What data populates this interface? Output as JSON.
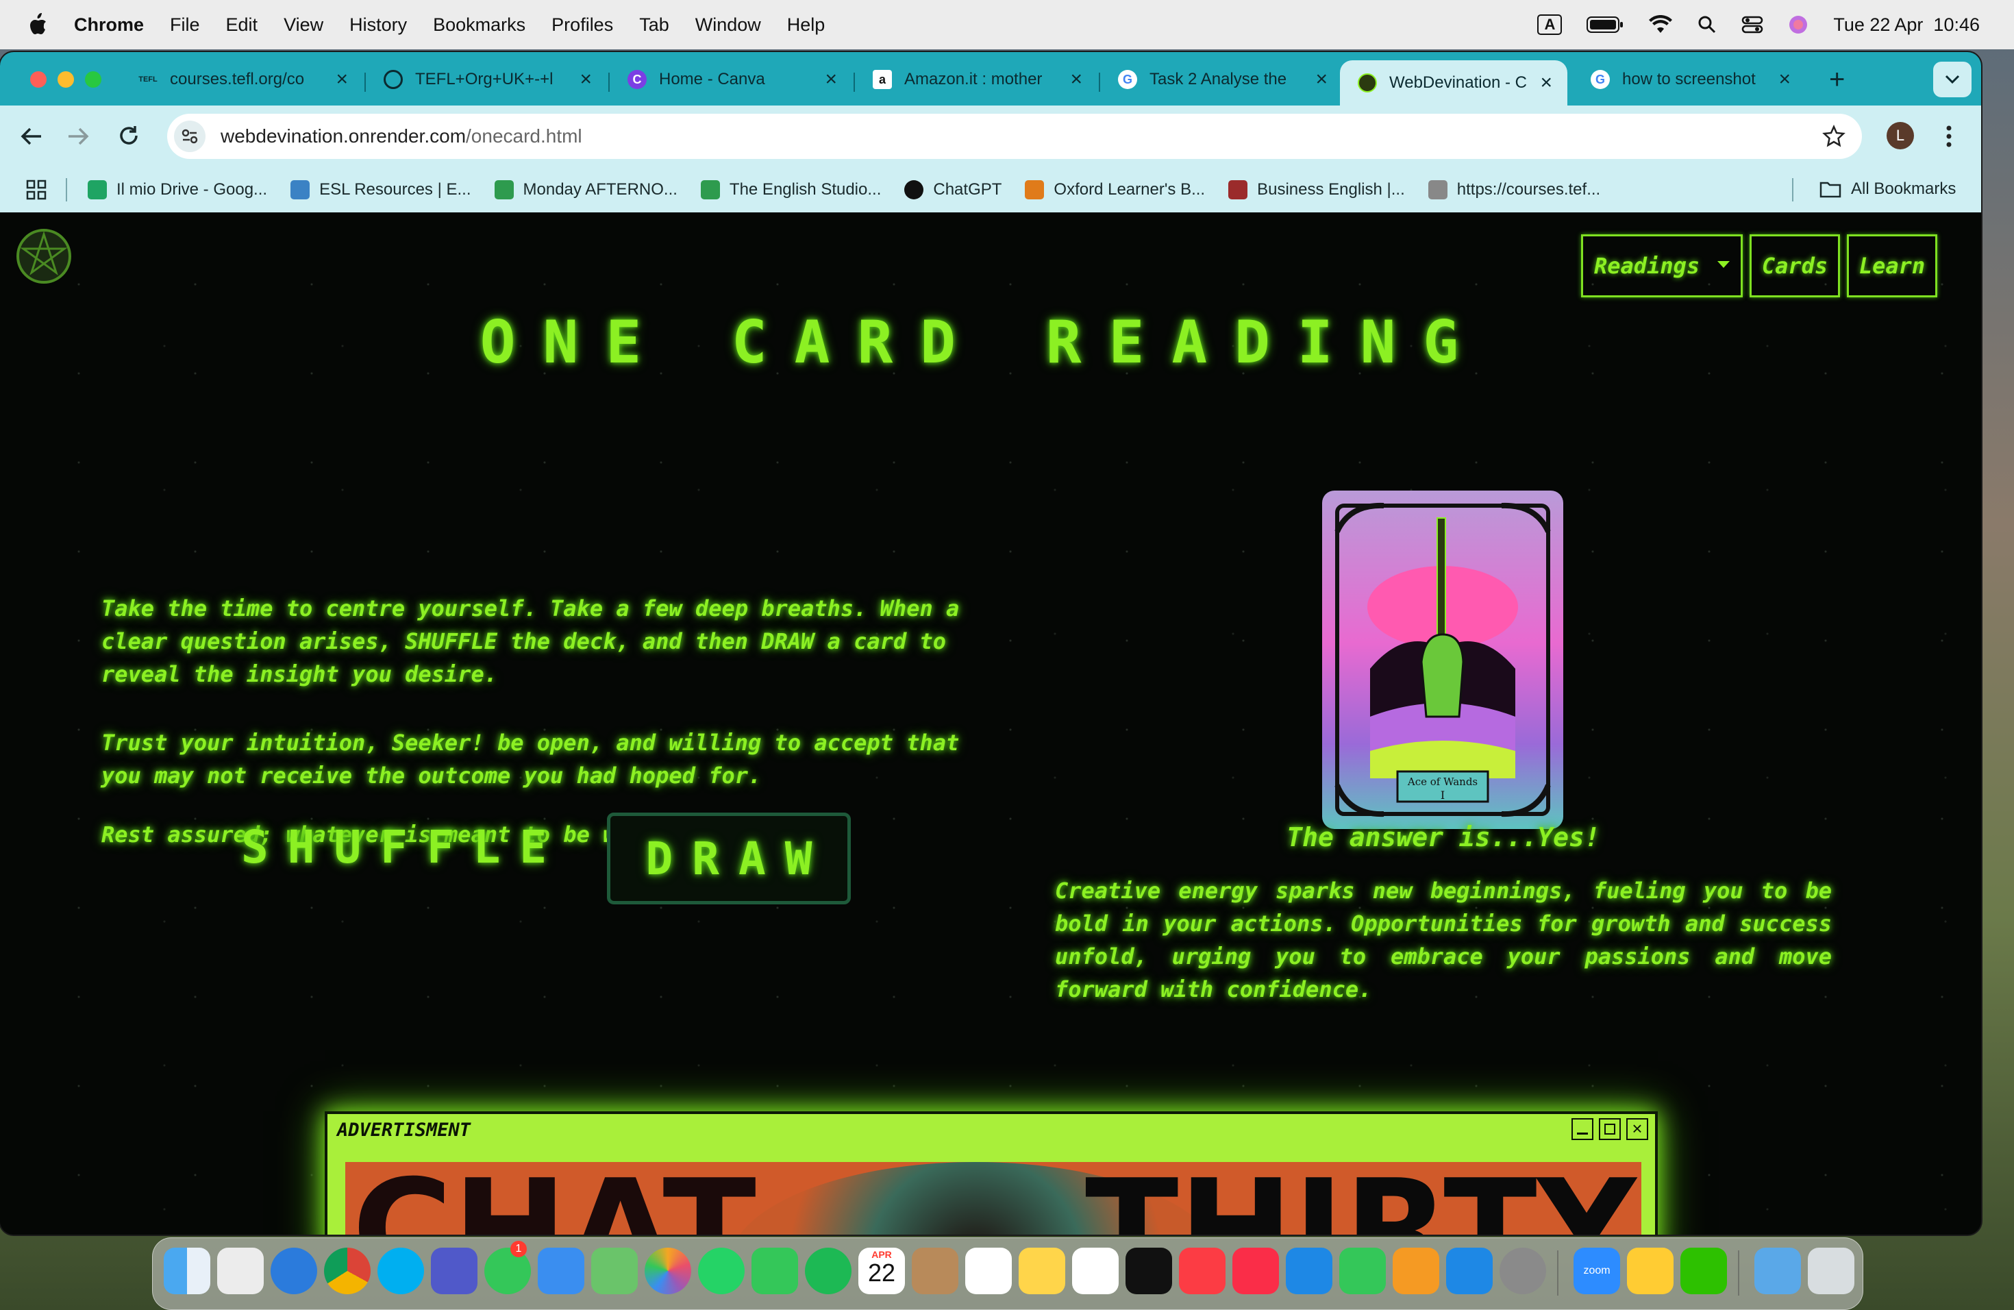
{
  "menubar": {
    "app": "Chrome",
    "items": [
      "File",
      "Edit",
      "View",
      "History",
      "Bookmarks",
      "Profiles",
      "Tab",
      "Window",
      "Help"
    ],
    "input_indicator": "A",
    "datetime": "Tue 22 Apr  10:46"
  },
  "tabs": [
    {
      "title": "courses.tefl.org/co",
      "favicon": "TEFL"
    },
    {
      "title": "TEFL+Org+UK+-+l",
      "favicon": "globe-icon"
    },
    {
      "title": "Home - Canva",
      "favicon": "C"
    },
    {
      "title": "Amazon.it : mother",
      "favicon": "a"
    },
    {
      "title": "Task 2 Analyse the",
      "favicon": "G"
    },
    {
      "title": "WebDevination - C",
      "favicon": "pentacle",
      "active": true
    },
    {
      "title": "how to screenshot",
      "favicon": "G"
    }
  ],
  "address": {
    "host": "webdevination.onrender.com",
    "path": "/onecard.html"
  },
  "profile_initial": "L",
  "bookmarks": [
    {
      "label": "Il mio Drive - Goog...",
      "color": "#1fa463"
    },
    {
      "label": "ESL Resources | E...",
      "color": "#3b82c4"
    },
    {
      "label": "Monday AFTERNO...",
      "color": "#2e9b4e"
    },
    {
      "label": "The English Studio...",
      "color": "#2e9b4e"
    },
    {
      "label": "ChatGPT",
      "color": "#111111"
    },
    {
      "label": "Oxford Learner's B...",
      "color": "#e07b1a"
    },
    {
      "label": "Business English |...",
      "color": "#9b2b2b"
    },
    {
      "label": "https://courses.tef...",
      "color": "#666666"
    }
  ],
  "all_bookmarks": "All Bookmarks",
  "site": {
    "nav": {
      "readings": "Readings",
      "cards": "Cards",
      "learn": "Learn"
    },
    "title": "ONE CARD READING",
    "intro_1": "Take the time to centre yourself. Take a few deep breaths. When a clear question arises, SHUFFLE the deck, and then DRAW a card to reveal the insight you desire.",
    "intro_2": "Trust your intuition, Seeker! be open, and willing to accept that you may not receive the outcome you had hoped for.",
    "intro_3": "Rest assured; whatever is meant to be will be...",
    "shuffle": "SHUFFLE",
    "draw": "DRAW",
    "card_name": "Ace of Wands",
    "card_numeral": "I",
    "answer": "The answer is...Yes!",
    "meaning": "Creative energy sparks new beginnings, fueling you to be bold in your actions. Opportunities for growth and success unfold, urging you to embrace your passions and move forward with confidence.",
    "ad_title": "ADVERTISMENT",
    "ad_text_left": "CHAT",
    "ad_text_right": "THIRTY",
    "neon_color": "#8cf023"
  },
  "dock": {
    "calendar_month": "APR",
    "calendar_day": "22",
    "messages_badge": "1",
    "zoom_label": "zoom"
  }
}
